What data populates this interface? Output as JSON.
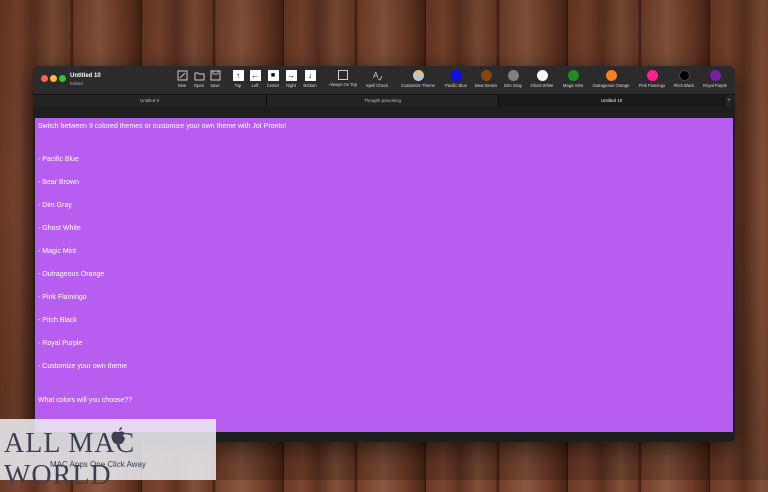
{
  "window": {
    "title": "Untitled 10",
    "subtitle": "Edited"
  },
  "toolbar": {
    "new": "New",
    "open": "Open",
    "save": "Save",
    "top": "Top",
    "left": "Left",
    "center": "Center",
    "right": "Right",
    "bottom": "Bottom",
    "always_on_top": "Always On Top",
    "spell_check": "Spell Check",
    "customize_theme": "Customize Theme",
    "themes": [
      {
        "label": "Pacific Blue",
        "color": "#1010e8"
      },
      {
        "label": "Bear Brown",
        "color": "#8b4513"
      },
      {
        "label": "Dim Gray",
        "color": "#808080"
      },
      {
        "label": "Ghost White",
        "color": "#f8f8ff"
      },
      {
        "label": "Magic Mint",
        "color": "#1e8c1e"
      },
      {
        "label": "Outrageous Orange",
        "color": "#ff7f1e"
      },
      {
        "label": "Pink Flamingo",
        "color": "#ff1f8f"
      },
      {
        "label": "Pitch Black",
        "color": "#000000"
      },
      {
        "label": "Royal Purple",
        "color": "#7a1fa0"
      }
    ]
  },
  "tabs": [
    {
      "label": "Untitled 9"
    },
    {
      "label": "Thought provoking"
    },
    {
      "label": "Untitled 10"
    }
  ],
  "editor": {
    "background": "#b75ef0",
    "lines": [
      "Switch between 9 colored themes or customize your own theme with Jot Pronto!",
      "- Pacific Blue",
      "- Bear Brown",
      "- Dim Gray",
      "- Ghost White",
      "- Magic Mint",
      "- Outrageous Orange",
      "- Pink Flamingo",
      "- Pitch Black",
      "- Royal Purple",
      "- Customize your own theme",
      "What colors will you choose??"
    ]
  },
  "watermark": {
    "title": "ALL MAC WORLD",
    "subtitle": "MAC Apps One Click Away"
  }
}
